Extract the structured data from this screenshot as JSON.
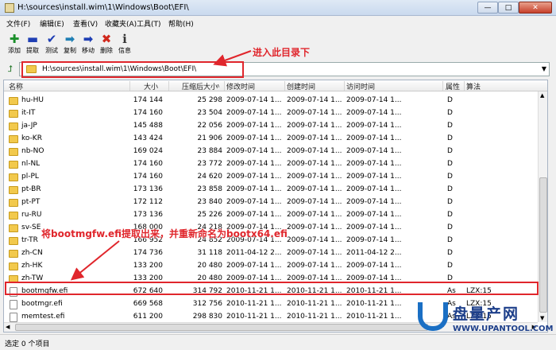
{
  "window": {
    "title": "H:\\sources\\install.wim\\1\\Windows\\Boot\\EFI\\",
    "buttons": {
      "minimize": "—",
      "maximize": "□",
      "close": "✕"
    }
  },
  "menu": [
    "文件(F)",
    "编辑(E)",
    "查看(V)",
    "收藏夹(A)",
    "工具(T)",
    "帮助(H)"
  ],
  "toolbar": [
    {
      "label": "添加",
      "icon": "add-icon",
      "glyph": "✚",
      "color": "#1a8f2a"
    },
    {
      "label": "提取",
      "icon": "extract-icon",
      "glyph": "▬",
      "color": "#1f3fb4"
    },
    {
      "label": "测试",
      "icon": "test-icon",
      "glyph": "✔",
      "color": "#1f3fb4"
    },
    {
      "label": "复制",
      "icon": "copy-icon",
      "glyph": "➡",
      "color": "#1f7fb4"
    },
    {
      "label": "移动",
      "icon": "move-icon",
      "glyph": "➡",
      "color": "#1f3fb4"
    },
    {
      "label": "删除",
      "icon": "delete-icon",
      "glyph": "✖",
      "color": "#d0281c"
    },
    {
      "label": "信息",
      "icon": "info-icon",
      "glyph": "ℹ",
      "color": "#333333"
    }
  ],
  "address": {
    "path": "H:\\sources\\install.wim\\1\\Windows\\Boot\\EFI\\",
    "up_icon": "up-folder-icon"
  },
  "columns": {
    "name": "名称",
    "size": "大小",
    "packed": "压缩后大小",
    "modified": "修改时间",
    "created": "创建时间",
    "accessed": "访问时间",
    "attributes": "属性",
    "method": "算法"
  },
  "rows": [
    {
      "name": "hu-HU",
      "type": "folder",
      "size": "174 144",
      "packed": "25 298",
      "modified": "2009-07-14 1...",
      "created": "2009-07-14 1...",
      "accessed": "2009-07-14 1...",
      "attr": "D",
      "method": ""
    },
    {
      "name": "it-IT",
      "type": "folder",
      "size": "174 160",
      "packed": "23 504",
      "modified": "2009-07-14 1...",
      "created": "2009-07-14 1...",
      "accessed": "2009-07-14 1...",
      "attr": "D",
      "method": ""
    },
    {
      "name": "ja-JP",
      "type": "folder",
      "size": "145 488",
      "packed": "22 056",
      "modified": "2009-07-14 1...",
      "created": "2009-07-14 1...",
      "accessed": "2009-07-14 1...",
      "attr": "D",
      "method": ""
    },
    {
      "name": "ko-KR",
      "type": "folder",
      "size": "143 424",
      "packed": "21 906",
      "modified": "2009-07-14 1...",
      "created": "2009-07-14 1...",
      "accessed": "2009-07-14 1...",
      "attr": "D",
      "method": ""
    },
    {
      "name": "nb-NO",
      "type": "folder",
      "size": "169 024",
      "packed": "23 884",
      "modified": "2009-07-14 1...",
      "created": "2009-07-14 1...",
      "accessed": "2009-07-14 1...",
      "attr": "D",
      "method": ""
    },
    {
      "name": "nl-NL",
      "type": "folder",
      "size": "174 160",
      "packed": "23 772",
      "modified": "2009-07-14 1...",
      "created": "2009-07-14 1...",
      "accessed": "2009-07-14 1...",
      "attr": "D",
      "method": ""
    },
    {
      "name": "pl-PL",
      "type": "folder",
      "size": "174 160",
      "packed": "24 620",
      "modified": "2009-07-14 1...",
      "created": "2009-07-14 1...",
      "accessed": "2009-07-14 1...",
      "attr": "D",
      "method": ""
    },
    {
      "name": "pt-BR",
      "type": "folder",
      "size": "173 136",
      "packed": "23 858",
      "modified": "2009-07-14 1...",
      "created": "2009-07-14 1...",
      "accessed": "2009-07-14 1...",
      "attr": "D",
      "method": ""
    },
    {
      "name": "pt-PT",
      "type": "folder",
      "size": "172 112",
      "packed": "23 840",
      "modified": "2009-07-14 1...",
      "created": "2009-07-14 1...",
      "accessed": "2009-07-14 1...",
      "attr": "D",
      "method": ""
    },
    {
      "name": "ru-RU",
      "type": "folder",
      "size": "173 136",
      "packed": "25 226",
      "modified": "2009-07-14 1...",
      "created": "2009-07-14 1...",
      "accessed": "2009-07-14 1...",
      "attr": "D",
      "method": ""
    },
    {
      "name": "sv-SE",
      "type": "folder",
      "size": "168 000",
      "packed": "24 218",
      "modified": "2009-07-14 1...",
      "created": "2009-07-14 1...",
      "accessed": "2009-07-14 1...",
      "attr": "D",
      "method": ""
    },
    {
      "name": "tr-TR",
      "type": "folder",
      "size": "166 952",
      "packed": "24 852",
      "modified": "2009-07-14 1...",
      "created": "2009-07-14 1...",
      "accessed": "2009-07-14 1...",
      "attr": "D",
      "method": ""
    },
    {
      "name": "zh-CN",
      "type": "folder",
      "size": "174 736",
      "packed": "31 118",
      "modified": "2011-04-12 2...",
      "created": "2009-07-14 1...",
      "accessed": "2011-04-12 2...",
      "attr": "D",
      "method": ""
    },
    {
      "name": "zh-HK",
      "type": "folder",
      "size": "133 200",
      "packed": "20 480",
      "modified": "2009-07-14 1...",
      "created": "2009-07-14 1...",
      "accessed": "2009-07-14 1...",
      "attr": "D",
      "method": ""
    },
    {
      "name": "zh-TW",
      "type": "folder",
      "size": "133 200",
      "packed": "20 480",
      "modified": "2009-07-14 1...",
      "created": "2009-07-14 1...",
      "accessed": "2009-07-14 1...",
      "attr": "D",
      "method": ""
    },
    {
      "name": "bootmgfw.efi",
      "type": "file",
      "size": "672 640",
      "packed": "314 792",
      "modified": "2010-11-21 1...",
      "created": "2010-11-21 1...",
      "accessed": "2010-11-21 1...",
      "attr": "As",
      "method": "LZX:15"
    },
    {
      "name": "bootmgr.efi",
      "type": "file",
      "size": "669 568",
      "packed": "312 756",
      "modified": "2010-11-21 1...",
      "created": "2010-11-21 1...",
      "accessed": "2010-11-21 1...",
      "attr": "As",
      "method": "LZX:15"
    },
    {
      "name": "memtest.efi",
      "type": "file",
      "size": "611 200",
      "packed": "298 830",
      "modified": "2010-11-21 1...",
      "created": "2010-11-21 1...",
      "accessed": "2010-11-21 1...",
      "attr": "As",
      "method": "LZX:15"
    }
  ],
  "status": "选定 0 个项目",
  "annotations": {
    "enter_dir": "进入此目录下",
    "extract_note": "将bootmgfw.efi提取出来，并重新命名为bootx64.efi"
  },
  "watermark": {
    "title": "盘量产网",
    "url": "WWW.UPANTOOL.COM",
    "logo_icon": "u-logo-icon"
  },
  "colors": {
    "annotation_red": "#e0262c",
    "folder_yellow": "#f2c94c",
    "watermark_blue": "#1d3f8a"
  }
}
